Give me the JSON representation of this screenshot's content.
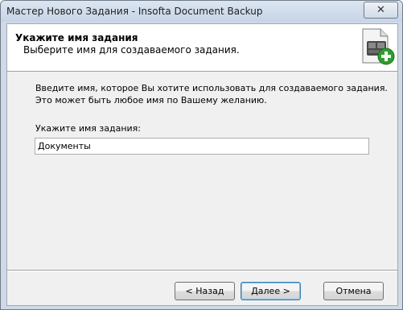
{
  "window": {
    "title": "Мастер Нового Задания - Insofta Document Backup",
    "close_symbol": "✕"
  },
  "header": {
    "title": "Укажите имя задания",
    "subtitle": "Выберите имя для создаваемого задания.",
    "icon": "document-add-icon"
  },
  "body": {
    "intro_line1": "Введите имя, которое Вы хотите использовать для создаваемого задания.",
    "intro_line2": "Это может быть любое имя по Вашему желанию.",
    "field_label": "Укажите имя задания:",
    "field_value": "Документы"
  },
  "buttons": {
    "back": "< Назад",
    "next": "Далее >",
    "cancel": "Отмена"
  },
  "colors": {
    "accent": "#3c7fb1",
    "plus_green": "#2e9e2e",
    "titlebar": "#c6d4e6"
  }
}
